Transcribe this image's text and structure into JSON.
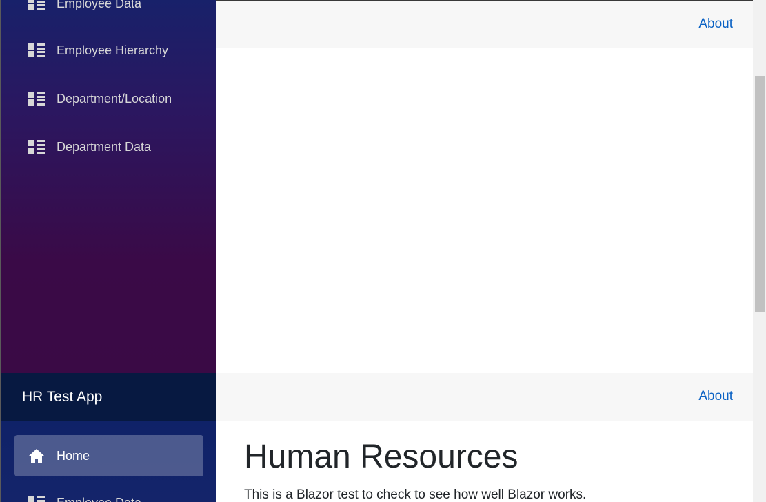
{
  "app": {
    "title": "HR Test App"
  },
  "topbar": {
    "about_label": "About"
  },
  "sidebar": {
    "items": [
      {
        "label": "Home",
        "icon": "home-icon",
        "active": true
      },
      {
        "label": "Employee Data",
        "icon": "list-icon",
        "active": false
      },
      {
        "label": "Employee Hierarchy",
        "icon": "list-icon",
        "active": false
      },
      {
        "label": "Department/Location",
        "icon": "list-icon",
        "active": false
      },
      {
        "label": "Department Data",
        "icon": "list-icon",
        "active": false
      }
    ]
  },
  "page": {
    "heading": "Human Resources",
    "text": "This is a Blazor test to check to see how well Blazor works."
  },
  "colors": {
    "link": "#0b62c4",
    "sidebar_top": "#18216a",
    "sidebar_bottom": "#3a0a47",
    "brand_bar": "#071941"
  }
}
